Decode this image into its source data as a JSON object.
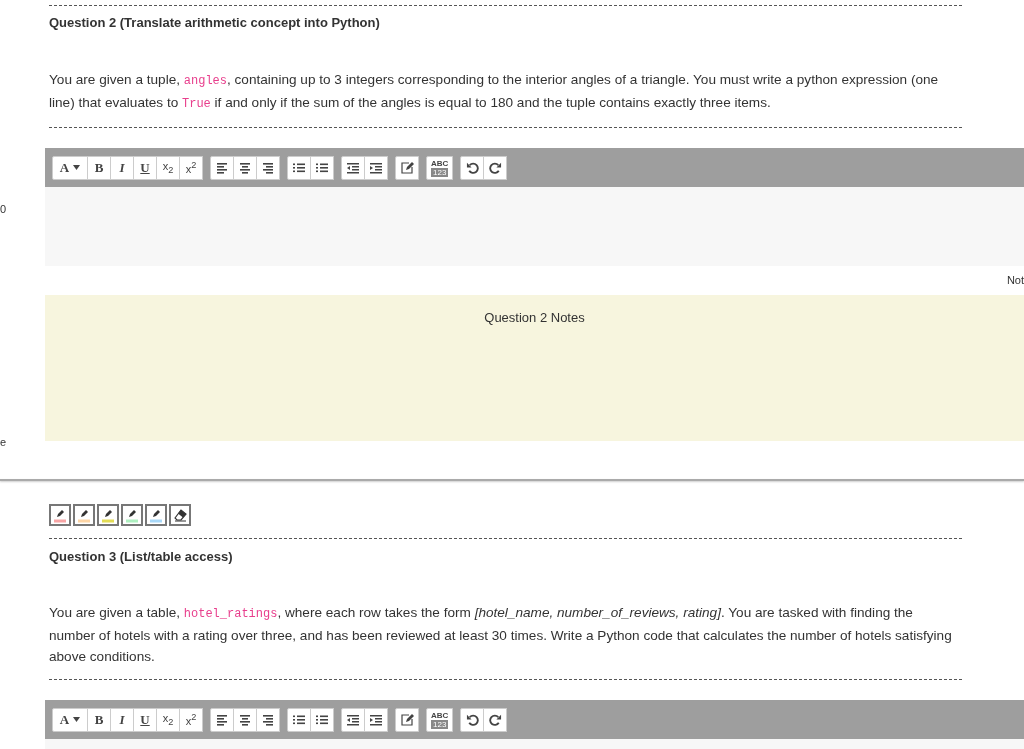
{
  "left_margin": {
    "top_fragment": "0",
    "bottom_fragment": "e"
  },
  "questions": [
    {
      "title": "Question 2 (Translate arithmetic concept into Python)",
      "prompt": [
        {
          "kind": "text",
          "text": "You are given a tuple, "
        },
        {
          "kind": "code",
          "text": "angles"
        },
        {
          "kind": "text",
          "text": ", containing up to 3 integers corresponding to the interior angles of a triangle. You must write a python expression (one line) that evaluates to "
        },
        {
          "kind": "code",
          "text": "True"
        },
        {
          "kind": "text",
          "text": " if and only if the sum of the angles is equal to 180 and the tuple contains exactly three items."
        }
      ],
      "toolbar": [
        [
          {
            "kind": "dropdown",
            "label": "A"
          },
          {
            "kind": "bold",
            "label": "B"
          },
          {
            "kind": "italic",
            "label": "I"
          },
          {
            "kind": "underline",
            "label": "U"
          },
          {
            "kind": "script",
            "label": "x$_{2}$"
          },
          {
            "kind": "script",
            "label": "x$^{2}$"
          }
        ],
        [
          {
            "kind": "align-left"
          },
          {
            "kind": "align-center"
          },
          {
            "kind": "align-right"
          }
        ],
        [
          {
            "kind": "bullets"
          },
          {
            "kind": "numbers"
          }
        ],
        [
          {
            "kind": "outdent"
          },
          {
            "kind": "indent"
          }
        ],
        [
          {
            "kind": "edit"
          }
        ],
        [
          {
            "kind": "spell",
            "label": "ABC",
            "sub": "123"
          }
        ],
        [
          {
            "kind": "undo"
          },
          {
            "kind": "redo"
          }
        ]
      ],
      "notes": {
        "side_label": "Not",
        "title": "Question 2 Notes"
      }
    },
    {
      "title": "Question 3 (List/table access)",
      "highlighters": [
        {
          "kind": "pen",
          "color": "#f8a5a5"
        },
        {
          "kind": "pen",
          "color": "#fdd5a5"
        },
        {
          "kind": "pen",
          "color": "#e3dc55"
        },
        {
          "kind": "pen",
          "color": "#aef0c0"
        },
        {
          "kind": "pen",
          "color": "#a8d8f8"
        },
        {
          "kind": "eraser"
        }
      ],
      "prompt": [
        {
          "kind": "text",
          "text": "You are given a table, "
        },
        {
          "kind": "code",
          "text": "hotel_ratings"
        },
        {
          "kind": "text",
          "text": ", where each row takes the form "
        },
        {
          "kind": "italic",
          "text": "[hotel_name, number_of_reviews, rating]"
        },
        {
          "kind": "text",
          "text": ". You are tasked with finding the number of hotels with a rating over three, and has been reviewed at least 30 times. Write a Python code that calculates the number of hotels satisfying above conditions."
        }
      ],
      "toolbar": [
        [
          {
            "kind": "dropdown",
            "label": "A"
          },
          {
            "kind": "bold",
            "label": "B"
          },
          {
            "kind": "italic",
            "label": "I"
          },
          {
            "kind": "underline",
            "label": "U"
          },
          {
            "kind": "script",
            "label": "x$_{2}$"
          },
          {
            "kind": "script",
            "label": "x$^{2}$"
          }
        ],
        [
          {
            "kind": "align-left"
          },
          {
            "kind": "align-center"
          },
          {
            "kind": "align-right"
          }
        ],
        [
          {
            "kind": "bullets"
          },
          {
            "kind": "numbers"
          }
        ],
        [
          {
            "kind": "outdent"
          },
          {
            "kind": "indent"
          }
        ],
        [
          {
            "kind": "edit"
          }
        ],
        [
          {
            "kind": "spell",
            "label": "ABC",
            "sub": "123"
          }
        ],
        [
          {
            "kind": "undo"
          },
          {
            "kind": "redo"
          }
        ]
      ]
    }
  ]
}
